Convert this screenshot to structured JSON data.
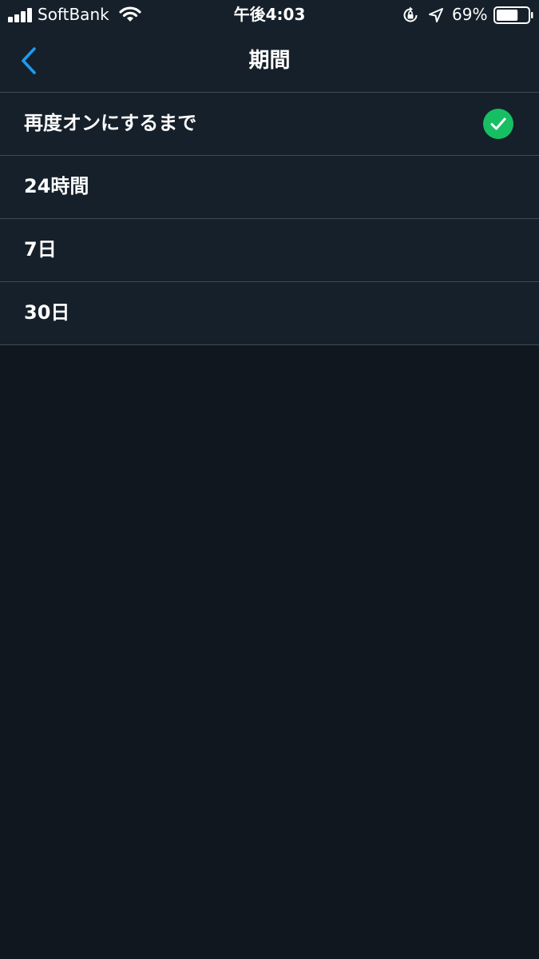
{
  "status_bar": {
    "carrier": "SoftBank",
    "time": "午後4:03",
    "battery_percent": "69%",
    "battery_level": 0.69,
    "signal_bars": 4,
    "icons": [
      "signal-icon",
      "wifi-icon",
      "rotation-lock-icon",
      "location-icon",
      "battery-icon"
    ]
  },
  "nav": {
    "title": "期間",
    "back_icon": "chevron-left-icon"
  },
  "options": [
    {
      "label": "再度オンにするまで",
      "selected": true
    },
    {
      "label": "24時間",
      "selected": false
    },
    {
      "label": "7日",
      "selected": false
    },
    {
      "label": "30日",
      "selected": false
    }
  ],
  "colors": {
    "background": "#10171f",
    "surface": "#16202a",
    "divider": "#3d4a57",
    "accent": "#1d9bf0",
    "check": "#17bf63",
    "text": "#ffffff"
  }
}
